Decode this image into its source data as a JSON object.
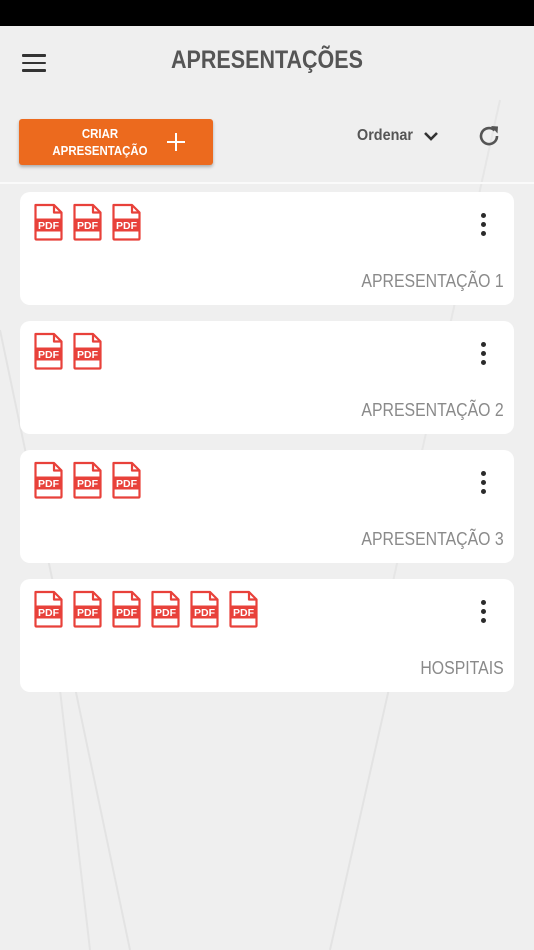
{
  "header": {
    "title": "APRESENTAÇÕES",
    "menu_icon": "hamburger-icon"
  },
  "toolbar": {
    "create_label_line1": "CRIAR",
    "create_label_line2": "APRESENTAÇÃO",
    "create_icon": "plus-icon",
    "sort_label": "Ordenar",
    "sort_icon": "chevron-down-icon",
    "refresh_icon": "refresh-icon"
  },
  "colors": {
    "accent": "#ec6a1e",
    "pdf_red": "#e8413a",
    "background": "#efefef"
  },
  "file_badge_text": "PDF",
  "presentations": [
    {
      "title": "APRESENTAÇÃO 1",
      "file_count": 3,
      "file_type": "PDF"
    },
    {
      "title": "APRESENTAÇÃO 2",
      "file_count": 2,
      "file_type": "PDF"
    },
    {
      "title": "APRESENTAÇÃO 3",
      "file_count": 3,
      "file_type": "PDF"
    },
    {
      "title": "HOSPITAIS",
      "file_count": 6,
      "file_type": "PDF"
    }
  ]
}
